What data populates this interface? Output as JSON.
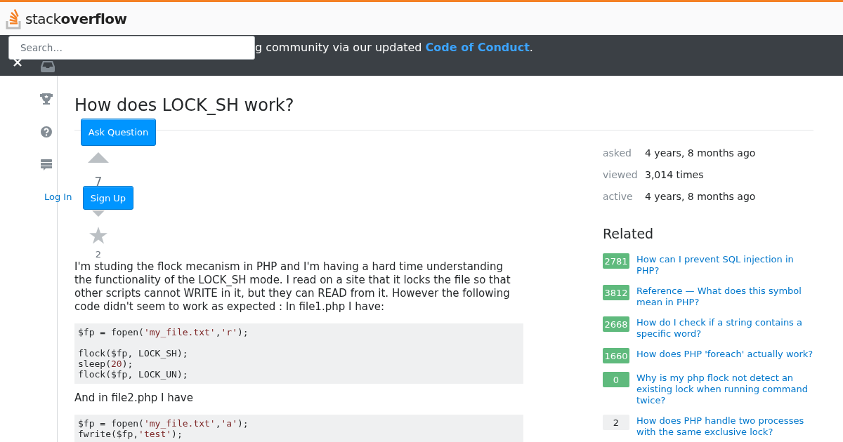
{
  "header": {
    "logo": "stack**overflow**",
    "search": {
      "placeholder": "Search…"
    }
  },
  "banner": {
    "text": "g community via our updated ",
    "link": "Code of Conduct",
    "end": "."
  },
  "auth": {
    "login": "Log In",
    "signup": "Sign Up"
  },
  "question": {
    "title": "How does LOCK_SH work?",
    "ask_button": "Ask Question",
    "votes": "7",
    "favorites": "2",
    "body": [
      {
        "kind": "text",
        "text": "I'm studing the flock mecanism in PHP and I'm having a hard time understanding the functionality of the LOCK_SH mode. I read on a site that it locks the file so that other scripts cannot WRITE in it, but they can READ from it. However the following code didn't seem to work as expected : In file1.php I have:"
      },
      {
        "kind": "code",
        "lines": [
          {
            "kind": "code",
            "tokens": [
              {
                "kind": "plain",
                "text": "$fp = fopen("
              },
              {
                "kind": "string",
                "text": "'my_file.txt'"
              },
              {
                "kind": "plain",
                "text": ","
              },
              {
                "kind": "string",
                "text": "'r'"
              },
              {
                "kind": "plain",
                "text": ");"
              }
            ]
          },
          {
            "kind": "blank"
          },
          {
            "kind": "code",
            "tokens": [
              {
                "kind": "plain",
                "text": "flock($fp, LOCK_SH);"
              }
            ]
          },
          {
            "kind": "code",
            "tokens": [
              {
                "kind": "plain",
                "text": "sleep("
              },
              {
                "kind": "number",
                "text": "20"
              },
              {
                "kind": "plain",
                "text": ");"
              }
            ]
          },
          {
            "kind": "code",
            "tokens": [
              {
                "kind": "plain",
                "text": "flock($fp, LOCK_UN);"
              }
            ]
          }
        ]
      },
      {
        "kind": "text",
        "text": "And in file2.php I have"
      },
      {
        "kind": "code",
        "lines": [
          {
            "kind": "code",
            "tokens": [
              {
                "kind": "plain",
                "text": "$fp = fopen("
              },
              {
                "kind": "string",
                "text": "'my_file.txt'"
              },
              {
                "kind": "plain",
                "text": ","
              },
              {
                "kind": "string",
                "text": "'a'"
              },
              {
                "kind": "plain",
                "text": ");"
              }
            ]
          },
          {
            "kind": "code",
            "tokens": [
              {
                "kind": "plain",
                "text": "fwrite($fp,"
              },
              {
                "kind": "string",
                "text": "'test'"
              },
              {
                "kind": "plain",
                "text": ");"
              }
            ]
          }
        ]
      }
    ]
  },
  "stats": [
    {
      "label": "asked",
      "value": "4 years, 8 months ago"
    },
    {
      "label": "viewed",
      "value": "3,014 times"
    },
    {
      "label": "active",
      "value": "4 years, 8 months ago"
    }
  ],
  "related": {
    "title": "Related",
    "items": [
      {
        "score": "2781",
        "accepted": true,
        "title": "How can I prevent SQL injection in PHP?"
      },
      {
        "score": "3812",
        "accepted": true,
        "title": "Reference — What does this symbol mean in PHP?"
      },
      {
        "score": "2668",
        "accepted": true,
        "title": "How do I check if a string contains a specific word?"
      },
      {
        "score": "1660",
        "accepted": true,
        "title": "How does PHP 'foreach' actually work?"
      },
      {
        "score": "0",
        "accepted": true,
        "title": "Why is my php flock not detect an existing lock when running command twice?"
      },
      {
        "score": "2",
        "accepted": false,
        "title": "How does PHP handle two processes with the same exclusive lock?"
      }
    ]
  }
}
